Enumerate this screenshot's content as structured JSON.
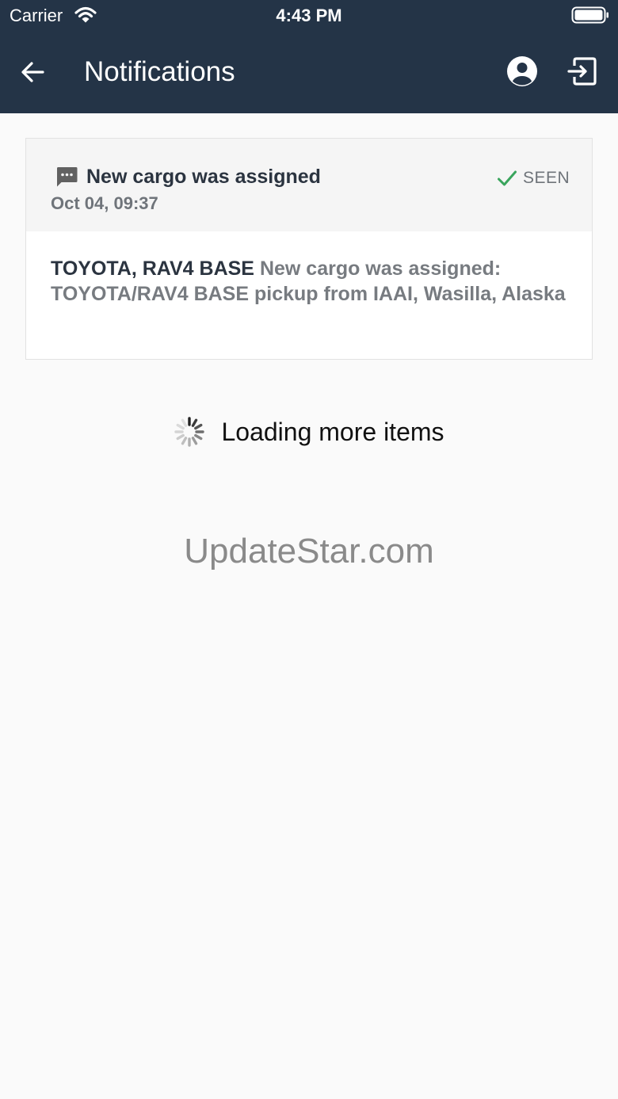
{
  "status_bar": {
    "carrier": "Carrier",
    "time": "4:43 PM"
  },
  "app_bar": {
    "title": "Notifications",
    "background": "#243447"
  },
  "notification": {
    "title": "New cargo was assigned",
    "date": "Oct 04, 09:37",
    "status": "SEEN",
    "vehicle": "TOYOTA, RAV4 BASE",
    "message": "New cargo was assigned: TOYOTA/RAV4 BASE pickup from IAAI, Wasilla, Alaska",
    "status_color": "#3aa55d"
  },
  "loading": {
    "text": "Loading more items"
  },
  "watermark": {
    "text": "UpdateStar.com"
  },
  "icons": {
    "back": "arrow-left-icon",
    "profile": "account-circle-icon",
    "logout": "logout-icon",
    "message": "message-icon",
    "check": "check-icon",
    "spinner": "spinner-icon"
  }
}
